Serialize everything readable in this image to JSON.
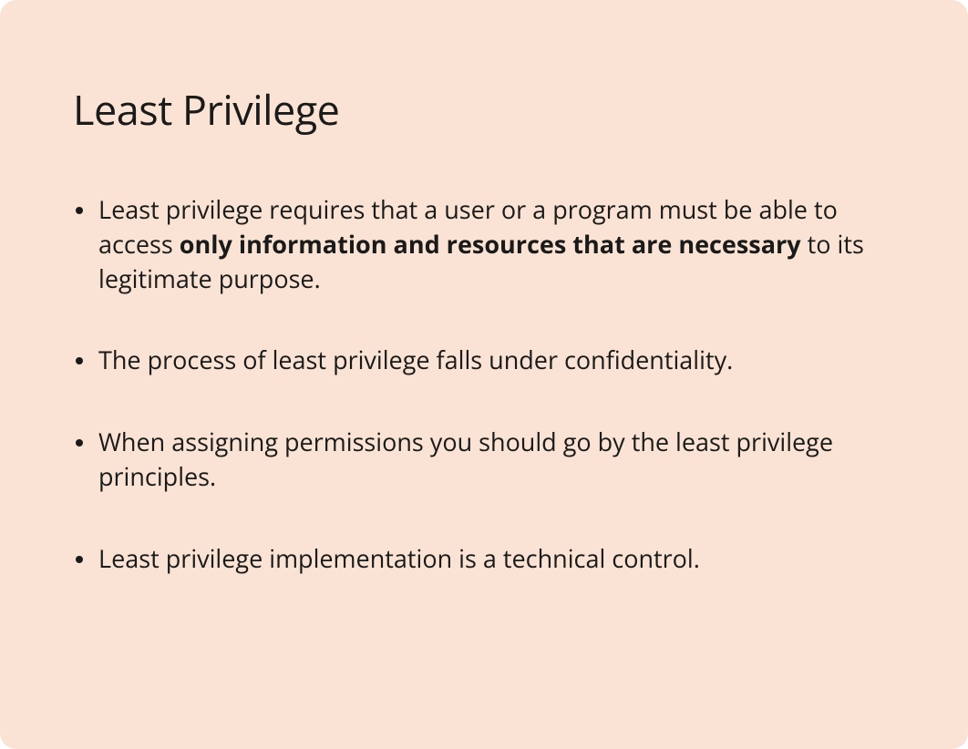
{
  "slide": {
    "title": "Least Privilege",
    "bullets": [
      {
        "pre": "Least privilege requires that a user or a program must be able to access ",
        "bold": "only information and resources that are necessary",
        "post": " to its legitimate purpose."
      },
      {
        "pre": "The process of least privilege falls under confidentiality.",
        "bold": "",
        "post": ""
      },
      {
        "pre": "When assigning permissions you should go by the least privilege principles.",
        "bold": "",
        "post": ""
      },
      {
        "pre": "Least privilege implementation is a technical control.",
        "bold": "",
        "post": ""
      }
    ]
  }
}
